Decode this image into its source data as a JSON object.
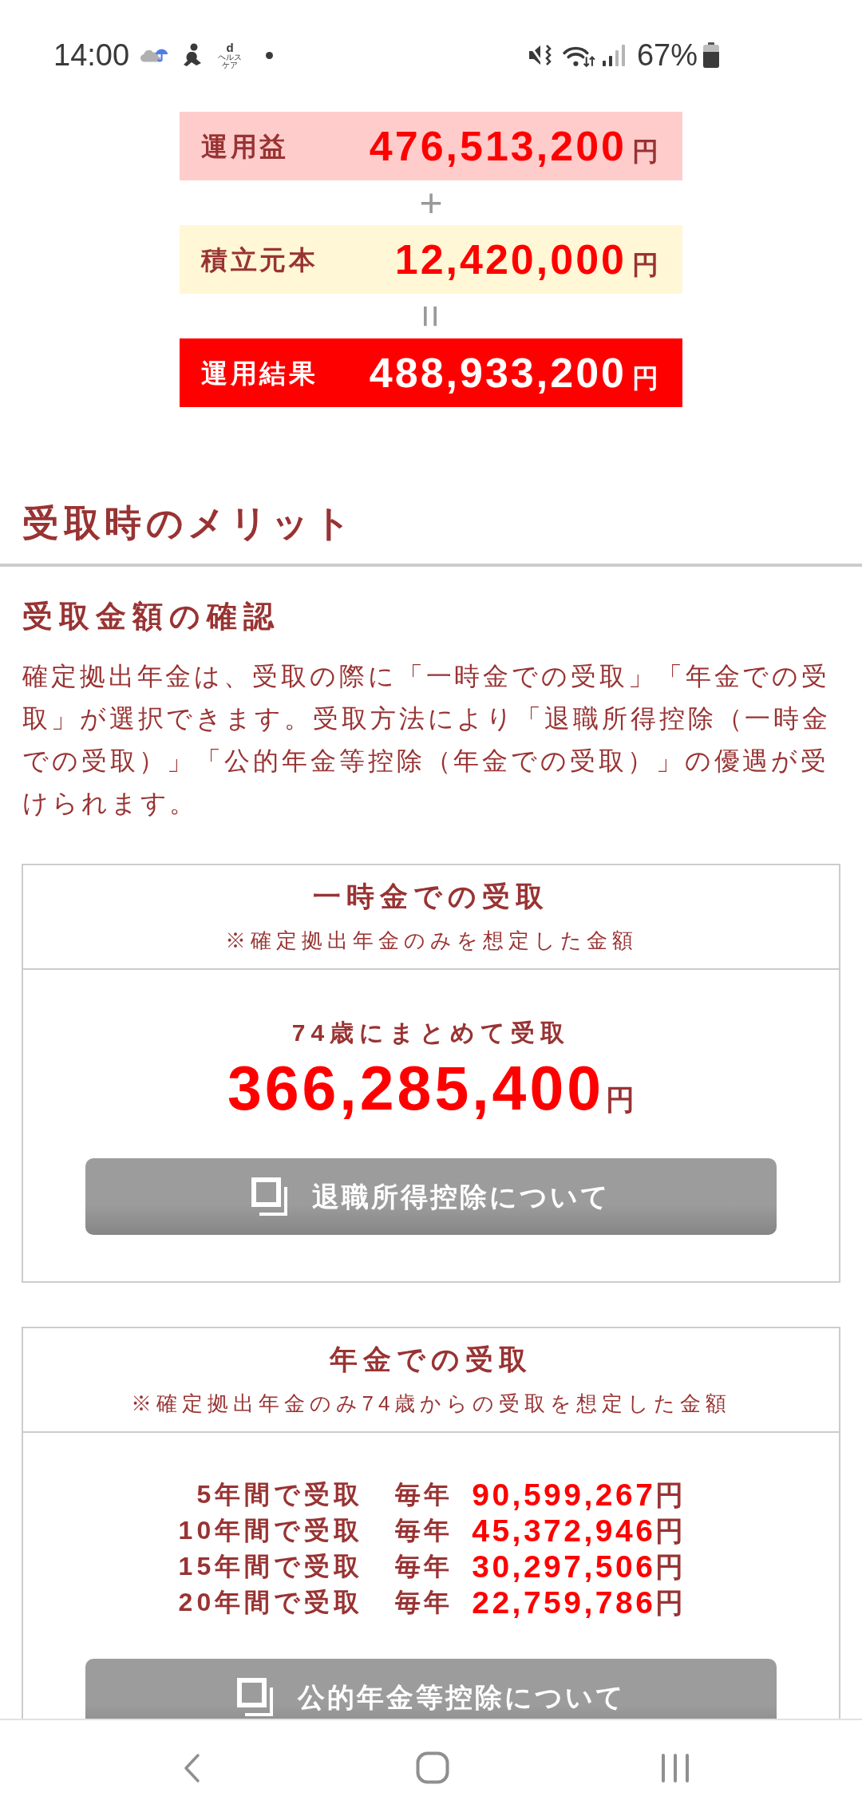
{
  "status_bar": {
    "time": "14:00",
    "app_badge": {
      "letter": "d",
      "label": "ヘルスケア"
    },
    "battery": "67%"
  },
  "summary": [
    {
      "kind": "gain",
      "label": "運用益",
      "amount": "476,513,200",
      "unit": "円"
    },
    {
      "kind": "plus",
      "symbol": "+"
    },
    {
      "kind": "principal",
      "label": "積立元本",
      "amount": "12,420,000",
      "unit": "円"
    },
    {
      "kind": "equals",
      "symbol": "="
    },
    {
      "kind": "result",
      "label": "運用結果",
      "amount": "488,933,200",
      "unit": "円"
    }
  ],
  "section": {
    "title": "受取時のメリット"
  },
  "subsection": {
    "title": "受取金額の確認",
    "body": "確定拠出年金は、受取の際に「一時金での受取」「年金での受取」が選択できます。受取方法により「退職所得控除（一時金での受取）」「公的年金等控除（年金での受取）」の優遇が受けられます。"
  },
  "cards": [
    {
      "kind": "lump_sum",
      "title": "一時金での受取",
      "note": "※確定拠出年金のみを想定した金額",
      "caption": "74歳にまとめて受取",
      "amount": "366,285,400",
      "unit": "円",
      "button": "退職所得控除について"
    },
    {
      "kind": "annuity",
      "title": "年金での受取",
      "note": "※確定拠出年金のみ74歳からの受取を想定した金額",
      "rows": [
        {
          "period": "5年間で受取",
          "frequency": "毎年",
          "amount": "90,599,267",
          "unit": "円"
        },
        {
          "period": "10年間で受取",
          "frequency": "毎年",
          "amount": "45,372,946",
          "unit": "円"
        },
        {
          "period": "15年間で受取",
          "frequency": "毎年",
          "amount": "30,297,506",
          "unit": "円"
        },
        {
          "period": "20年間で受取",
          "frequency": "毎年",
          "amount": "22,759,786",
          "unit": "円"
        }
      ],
      "button": "公的年金等控除について"
    }
  ]
}
